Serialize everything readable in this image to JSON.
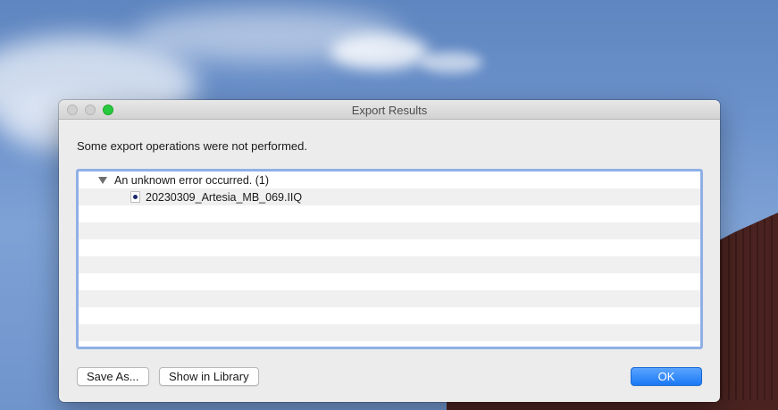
{
  "window": {
    "title": "Export Results",
    "message": "Some export operations were not performed.",
    "accent_color": "#1a79f5"
  },
  "results": {
    "group_label": "An unknown error occurred. (1)",
    "files": [
      "20230309_Artesia_MB_069.IIQ"
    ]
  },
  "buttons": {
    "save_as": "Save As...",
    "show_in_library": "Show in Library",
    "ok": "OK"
  },
  "icons": {
    "disclosure": "disclosure-triangle-down",
    "file": "raw-image-file"
  }
}
